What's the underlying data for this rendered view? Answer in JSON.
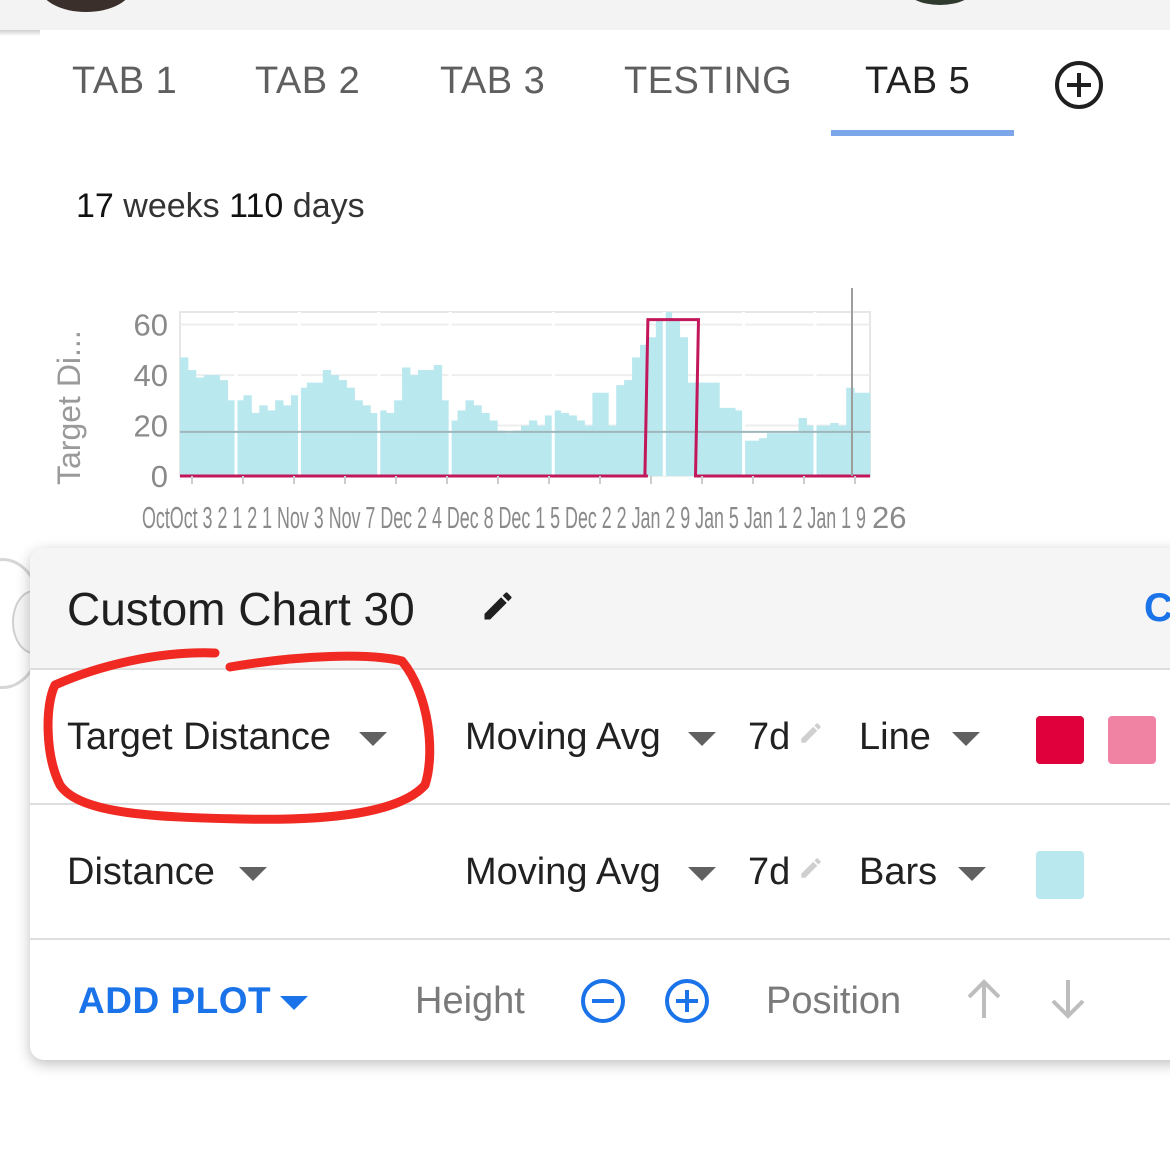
{
  "tabs": [
    {
      "label": "TAB 1",
      "active": false
    },
    {
      "label": "TAB 2",
      "active": false
    },
    {
      "label": "TAB 3",
      "active": false
    },
    {
      "label": "TESTING",
      "active": false
    },
    {
      "label": "TAB 5",
      "active": true
    }
  ],
  "summary": {
    "weeks_value": "17",
    "weeks_unit": "weeks",
    "days_value": "110",
    "days_unit": "days"
  },
  "colors": {
    "accent": "#1a73e8",
    "tab_indicator": "#7ca6ea",
    "line_series": "#c2185b",
    "bars_series": "#b9e8ee",
    "swatch_red": "#e0003c",
    "swatch_pink": "#f083a4",
    "swatch_cyan": "#b9e8ee",
    "annotation": "#f02a22"
  },
  "chart_data": {
    "type": "bar",
    "ylabel": "Target Di...",
    "ylim": [
      0,
      65
    ],
    "yticks": [
      "0",
      "20",
      "40",
      "60"
    ],
    "x_tick_overlap_text": "OctOct 3 2 1 2 1 Nov 3 Nov 7 Dec 2 4 Dec 8 Dec 1 5 Dec 2 2 Jan 2 9 Jan 5 Jan 1 2 Jan 1 9",
    "x_tick_last": "26",
    "series": [
      {
        "name": "Distance",
        "kind": "bars",
        "values": [
          47,
          42,
          39,
          40,
          40,
          38,
          30,
          30,
          32,
          25,
          28,
          26,
          30,
          28,
          32,
          35,
          37,
          37,
          42,
          40,
          38,
          35,
          30,
          28,
          25,
          26,
          25,
          30,
          43,
          40,
          42,
          42,
          44,
          30,
          22,
          26,
          30,
          28,
          25,
          22,
          18,
          17,
          18,
          20,
          22,
          20,
          24,
          26,
          25,
          24,
          22,
          20,
          33,
          33,
          20,
          36,
          38,
          47,
          52,
          55,
          62,
          65,
          62,
          55,
          37,
          37,
          37,
          37,
          27,
          27,
          26,
          14,
          14,
          15,
          17,
          17,
          17,
          17,
          23,
          20,
          20,
          20,
          21,
          20,
          35,
          33,
          33
        ]
      },
      {
        "name": "Target Distance",
        "kind": "line",
        "values": [
          0,
          0,
          0,
          0,
          0,
          0,
          0,
          0,
          0,
          0,
          0,
          0,
          0,
          0,
          0,
          0,
          0,
          0,
          0,
          0,
          0,
          0,
          0,
          0,
          0,
          0,
          0,
          0,
          0,
          0,
          0,
          0,
          0,
          0,
          0,
          0,
          0,
          0,
          0,
          0,
          0,
          0,
          0,
          0,
          0,
          0,
          0,
          0,
          0,
          0,
          0,
          0,
          0,
          0,
          0,
          0,
          0,
          0,
          0,
          62,
          62,
          62,
          62,
          62,
          62,
          0,
          0,
          0,
          0,
          0,
          0,
          0,
          0,
          0,
          0,
          0,
          0,
          0,
          0,
          0,
          0,
          0,
          0,
          0,
          0,
          0,
          0
        ]
      }
    ],
    "reference_line_value": 17.5
  },
  "card": {
    "title": "Custom Chart 30",
    "right_letter": "C",
    "plots": [
      {
        "metric": "Target Distance",
        "aggregation": "Moving Avg",
        "window": "7d",
        "style": "Line",
        "swatches": [
          "#e0003c",
          "#f083a4"
        ]
      },
      {
        "metric": "Distance",
        "aggregation": "Moving Avg",
        "window": "7d",
        "style": "Bars",
        "swatches": [
          "#b9e8ee"
        ]
      }
    ],
    "footer": {
      "add_plot": "ADD PLOT",
      "height_label": "Height",
      "position_label": "Position"
    }
  }
}
